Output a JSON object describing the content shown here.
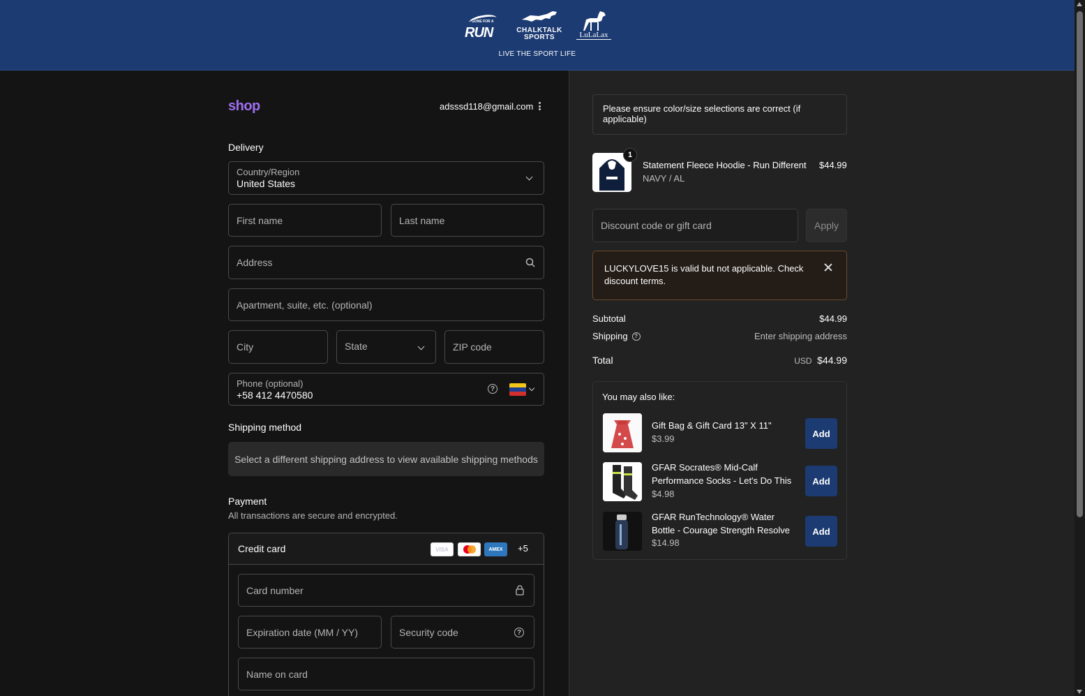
{
  "header": {
    "logos": [
      {
        "name": "gone-for-a-run",
        "text": "RUN",
        "sub": "GONE FOR A"
      },
      {
        "name": "chalktalk-sports",
        "line1": "CHALKTALK",
        "line2": "SPORTS"
      },
      {
        "name": "lulalax",
        "text": "LuLaLax"
      }
    ],
    "tagline": "LIVE THE SPORT LIFE"
  },
  "account": {
    "shop_label": "shop",
    "email": "adsssd118@gmail.com"
  },
  "delivery": {
    "title": "Delivery",
    "country_label": "Country/Region",
    "country_value": "United States",
    "first_name_placeholder": "First name",
    "last_name_placeholder": "Last name",
    "address_placeholder": "Address",
    "apartment_placeholder": "Apartment, suite, etc. (optional)",
    "city_placeholder": "City",
    "state_placeholder": "State",
    "zip_placeholder": "ZIP code",
    "phone_label": "Phone (optional)",
    "phone_value": "+58 412 4470580"
  },
  "shipping": {
    "title": "Shipping method",
    "note": "Select a different shipping address to view available shipping methods"
  },
  "payment": {
    "title": "Payment",
    "subtitle": "All transactions are secure and encrypted.",
    "method": "Credit card",
    "card_logos": [
      "VISA",
      "mastercard",
      "AMEX"
    ],
    "more": "+5",
    "card_number_placeholder": "Card number",
    "expiry_placeholder": "Expiration date (MM / YY)",
    "cvc_placeholder": "Security code",
    "name_placeholder": "Name on card"
  },
  "summary": {
    "notice": "Please ensure color/size selections are correct (if applicable)",
    "item": {
      "title": "Statement Fleece Hoodie - Run Different",
      "variant": "NAVY / AL",
      "price": "$44.99",
      "qty": "1"
    },
    "discount_placeholder": "Discount code or gift card",
    "apply_label": "Apply",
    "error_message": "LUCKYLOVE15 is valid but not applicable. Check discount terms.",
    "subtotal_label": "Subtotal",
    "subtotal_value": "$44.99",
    "shipping_label": "Shipping",
    "shipping_value": "Enter shipping address",
    "total_label": "Total",
    "total_currency": "USD",
    "total_value": "$44.99"
  },
  "upsell": {
    "title": "You may also like:",
    "items": [
      {
        "title": "Gift Bag & Gift Card 13\" X 11\"",
        "price": "$3.99",
        "button": "Add"
      },
      {
        "title": "GFAR Socrates® Mid-Calf Performance Socks - Let's Do This",
        "price": "$4.98",
        "button": "Add"
      },
      {
        "title": "GFAR RunTechnology® Water Bottle - Courage Strength Resolve",
        "price": "$14.98",
        "button": "Add"
      }
    ]
  },
  "colors": {
    "header_bg": "#1c3b72",
    "shop_brand": "#9f6ff0",
    "add_button": "#1c3b72"
  }
}
